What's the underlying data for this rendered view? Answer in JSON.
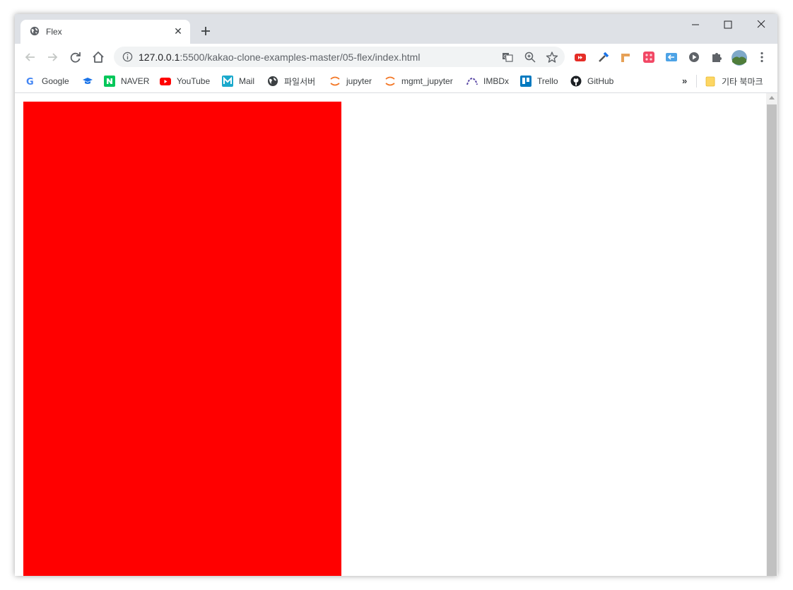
{
  "tab": {
    "title": "Flex",
    "close_label": "✕",
    "newtab_label": "+"
  },
  "window_controls": {
    "minimize": "—",
    "maximize": "☐",
    "close": "✕"
  },
  "address": {
    "url_host": "127.0.0.1",
    "url_rest": ":5500/kakao-clone-examples-master/05-flex/index.html"
  },
  "bookmarks": [
    {
      "label": "Google",
      "icon": "google-icon"
    },
    {
      "label": "",
      "icon": "graduation-cap-icon"
    },
    {
      "label": "NAVER",
      "icon": "naver-icon"
    },
    {
      "label": "YouTube",
      "icon": "youtube-icon"
    },
    {
      "label": "Mail",
      "icon": "mail-icon"
    },
    {
      "label": "파일서버",
      "icon": "globe-icon"
    },
    {
      "label": "jupyter",
      "icon": "jupyter-icon"
    },
    {
      "label": "mgmt_jupyter",
      "icon": "jupyter-icon"
    },
    {
      "label": "IMBDx",
      "icon": "imbdx-icon"
    },
    {
      "label": "Trello",
      "icon": "trello-icon"
    },
    {
      "label": "GitHub",
      "icon": "github-icon"
    }
  ],
  "bookmarks_more": "»",
  "other_bookmarks": "기타 북마크",
  "colors": {
    "content_box": "#ff0000",
    "tab_strip": "#dee1e6"
  }
}
